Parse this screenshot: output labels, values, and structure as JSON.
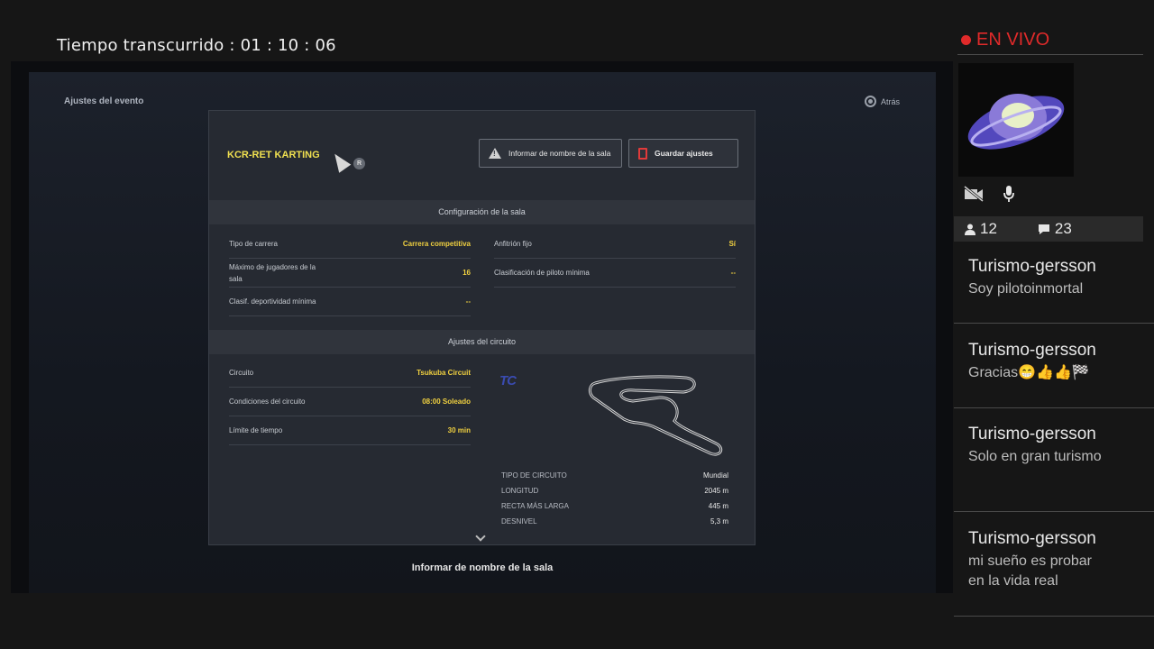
{
  "stream": {
    "elapsed_label": "Tiempo transcurrido : 01 : 10 : 06",
    "live_label": "EN VIVO",
    "viewers": "12",
    "comments": "23"
  },
  "game": {
    "event_title": "Ajustes del evento",
    "back_label": "Atrás",
    "room_name": "KCR-RET KARTING",
    "r_badge": "R",
    "report_button": "Informar de nombre de la sala",
    "save_button": "Guardar ajustes",
    "room_section": "Configuración de la sala",
    "room_rows_left": [
      {
        "label": "Tipo de carrera",
        "value": "Carrera competitiva"
      },
      {
        "label": "Máximo de jugadores de la sala",
        "value": "16"
      },
      {
        "label": "Clasif. deportividad mínima",
        "value": "--"
      }
    ],
    "room_rows_right": [
      {
        "label": "Anfitrión fijo",
        "value": "Sí"
      },
      {
        "label": "Clasificación de piloto mínima",
        "value": "--"
      }
    ],
    "circuit_section": "Ajustes del circuito",
    "circuit_rows": [
      {
        "label": "Circuito",
        "value": "Tsukuba Circuit"
      },
      {
        "label": "Condiciones del circuito",
        "value": "08:00 Soleado"
      },
      {
        "label": "Límite de tiempo",
        "value": "30 min"
      }
    ],
    "circuit_logo_text": "TC",
    "specs": [
      {
        "label": "TIPO DE CIRCUITO",
        "value": "Mundial"
      },
      {
        "label": "LONGITUD",
        "value": "2045 m"
      },
      {
        "label": "RECTA MÁS LARGA",
        "value": "445 m"
      },
      {
        "label": "DESNIVEL",
        "value": "5,3 m"
      }
    ],
    "footer_label": "Informar de nombre de la sala"
  },
  "chat": [
    {
      "user": "Turismo-gersson",
      "text": "Soy pilotoinmortal"
    },
    {
      "user": "Turismo-gersson",
      "text": "Gracias😁👍👍🏁"
    },
    {
      "user": "Turismo-gersson",
      "text": "Solo en gran turismo"
    },
    {
      "user": "Turismo-gersson",
      "text": "mi sueño es probar en la vida real"
    }
  ]
}
